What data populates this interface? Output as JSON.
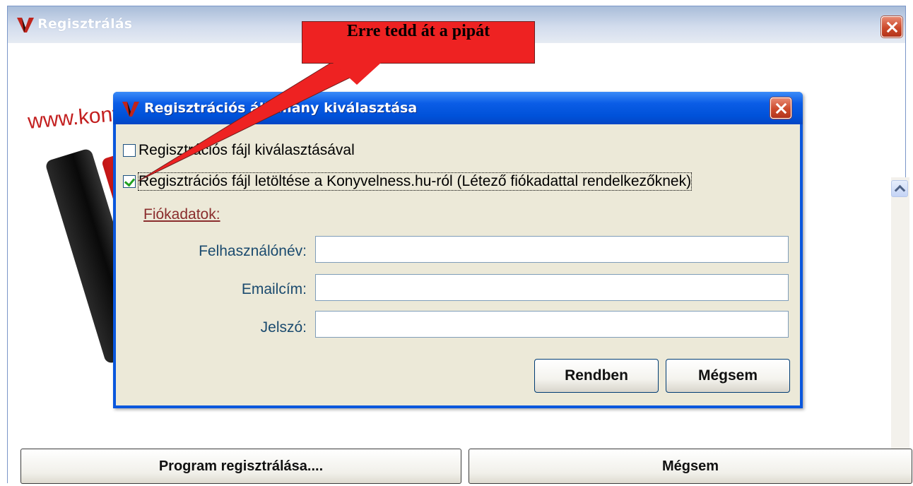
{
  "outer_window": {
    "title": "Regisztrálás",
    "background_text": "www.konyvelness.hu",
    "buttons": {
      "register": "Program regisztrálása....",
      "cancel": "Mégsem"
    }
  },
  "dialog": {
    "title": "Regisztrációs állomány kiválasztása",
    "options": [
      {
        "label": "Regisztrációs fájl kiválasztásával",
        "checked": false
      },
      {
        "label": "Regisztrációs fájl letöltése a Konyvelness.hu-ról (Létező fiókadattal rendelkezőknek)",
        "checked": true
      }
    ],
    "section_label": "Fiókadatok:",
    "fields": [
      {
        "label": "Felhasználónév:",
        "value": ""
      },
      {
        "label": "Emailcím:",
        "value": ""
      },
      {
        "label": "Jelszó:",
        "value": ""
      }
    ],
    "buttons": {
      "ok": "Rendben",
      "cancel": "Mégsem"
    }
  },
  "callout": {
    "text": "Erre tedd át a pipát"
  },
  "icons": [
    "app-logo-icon",
    "close-icon",
    "scroll-up-icon",
    "scroll-down-icon",
    "checkbox-icon"
  ],
  "colors": {
    "dialog_titlebar": "#0a57dd",
    "callout": "#ee2222",
    "url_text": "#c31f1f",
    "link": "#8a2d2d"
  }
}
